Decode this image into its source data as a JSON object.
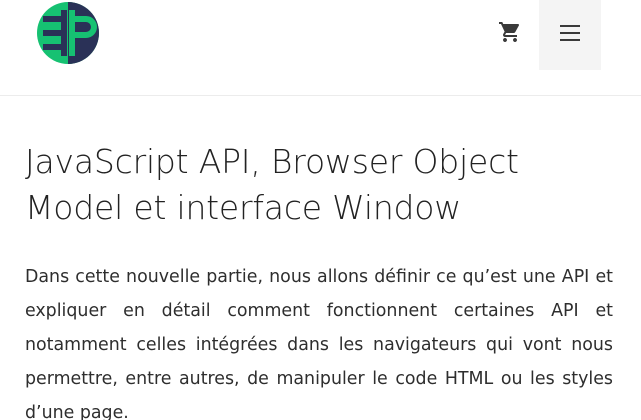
{
  "header": {
    "logo_icon": "pierre-giraud-logo-icon",
    "cart_icon": "shopping-cart-icon",
    "menu_icon": "hamburger-menu-icon",
    "colors": {
      "logo_green": "#16c172",
      "logo_navy": "#2a3157",
      "menu_background": "#f4f4f4",
      "icon": "#3a3a3a"
    }
  },
  "article": {
    "title": "JavaScript API, Browser Object Model et interface Window",
    "intro": "Dans cette nouvelle partie, nous allons définir ce qu’est une API et expliquer en détail comment fonctionnent certaines API et notamment celles intégrées dans les navigateurs qui vont nous permettre, entre autres, de manipuler le code HTML ou les styles d’une page."
  }
}
